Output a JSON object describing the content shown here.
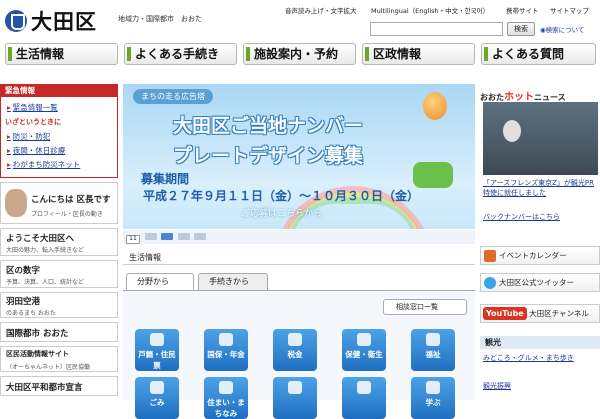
{
  "header": {
    "site_name": "大田区",
    "tagline": "地域力・国際都市　おおた",
    "utility_links": [
      "音声読み上げ・文字拡大",
      "Multilingual（English・中文・한국어）",
      "携帯サイト",
      "サイトマップ"
    ],
    "search_button": "検索",
    "search_help": "検索について",
    "search_placeholder": ""
  },
  "nav": [
    {
      "label": "生活情報"
    },
    {
      "label": "よくある手続き"
    },
    {
      "label": "施設案内・予約"
    },
    {
      "label": "区政情報"
    },
    {
      "label": "よくある質問"
    }
  ],
  "emergency": {
    "title": "緊急情報",
    "links": [
      "緊急情報一覧"
    ],
    "sub_title": "いざというときに",
    "sub_links": [
      "防災・防犯",
      "夜間・休日診療",
      "わがまち防災ネット"
    ]
  },
  "left_boxes": [
    {
      "title": "こんにちは 区長です",
      "sub": "プロフィール・区長の動き"
    },
    {
      "title": "ようこそ大田区へ",
      "sub": "大田の魅力、転入手続きなど"
    },
    {
      "title": "区の数字",
      "sub": "予算、決算、人口、統計など"
    },
    {
      "title": "羽田空港",
      "sub": "のあるまち おおた"
    },
    {
      "title": "国際都市 おおた",
      "sub": ""
    },
    {
      "title": "区民活動情報サイト",
      "sub": "（オーちゃんネット）区民協働"
    },
    {
      "title": "大田区平和都市宣言",
      "sub": ""
    }
  ],
  "banner": {
    "tag": "まちの走る広告塔",
    "line1": "大田区ご当地ナンバー",
    "line2": "プレートデザイン募集",
    "period_label": "募集期間",
    "period": "平成２７年９月１１日（金）～１０月３０日（金）",
    "cta": "ご応募はこちらから",
    "slide_indicator": "11"
  },
  "main": {
    "section_title": "生活情報",
    "tabs": [
      "分野から",
      "手続きから"
    ],
    "window_list": "相談窓口一覧",
    "categories": [
      "戸籍・住民票",
      "国保・年金",
      "税金",
      "保健・衛生",
      "福祉",
      "ごみ",
      "住まい・まちなみ",
      "",
      "",
      "学ぶ"
    ]
  },
  "right": {
    "news_prefix": "おおた",
    "news_hot": "ホット",
    "news_suffix": "ニュース",
    "news_link1": "「アースフレンズ東京Z」が観光PR特使に就任しました",
    "news_link2": "バックナンバーはこちら",
    "boxes": [
      "イベントカレンダー",
      "大田区公式ツイッター",
      "大田区チャンネル"
    ],
    "youtube": "YouTube",
    "kanko_title": "観光",
    "kanko_links": [
      "みどころ・グルメ・まち歩き",
      "観光振興"
    ]
  },
  "colors": {
    "brand_blue": "#2653a6",
    "emergency_red": "#c62828",
    "hot_red": "#e0301e",
    "nav_green": "#6aa92a"
  }
}
